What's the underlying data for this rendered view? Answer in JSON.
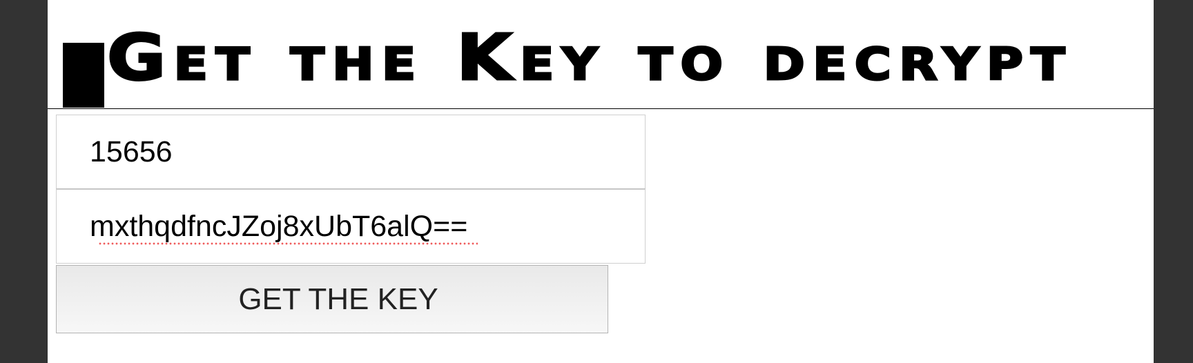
{
  "heading": {
    "title": "Get the Key to decrypt"
  },
  "form": {
    "key_value": "15656",
    "ciphertext_value": "mxthqdfncJZoj8xUbT6alQ==",
    "submit_label": "GET THE KEY"
  },
  "colors": {
    "background_outer": "#333333",
    "page": "#ffffff",
    "text": "#000000",
    "spellcheck": "#ef5a5a"
  }
}
